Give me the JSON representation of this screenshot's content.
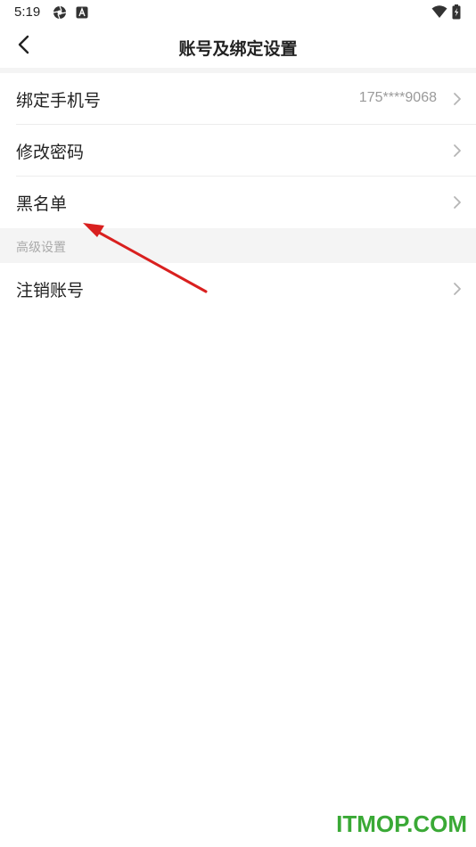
{
  "status_bar": {
    "time": "5:19",
    "icons": [
      "aperture-icon",
      "a-box-icon",
      "wifi-icon",
      "battery-icon"
    ]
  },
  "header": {
    "title": "账号及绑定设置",
    "back_icon": "chevron-left-icon"
  },
  "settings": {
    "rows": [
      {
        "label": "绑定手机号",
        "value": "175****9068"
      },
      {
        "label": "修改密码",
        "value": ""
      },
      {
        "label": "黑名单",
        "value": ""
      }
    ]
  },
  "advanced": {
    "header": "高级设置",
    "rows": [
      {
        "label": "注销账号",
        "value": ""
      }
    ]
  },
  "annotation": {
    "color": "#d9201f"
  },
  "watermark": {
    "text": "ITMOP.COM",
    "color": "#3aa936"
  }
}
